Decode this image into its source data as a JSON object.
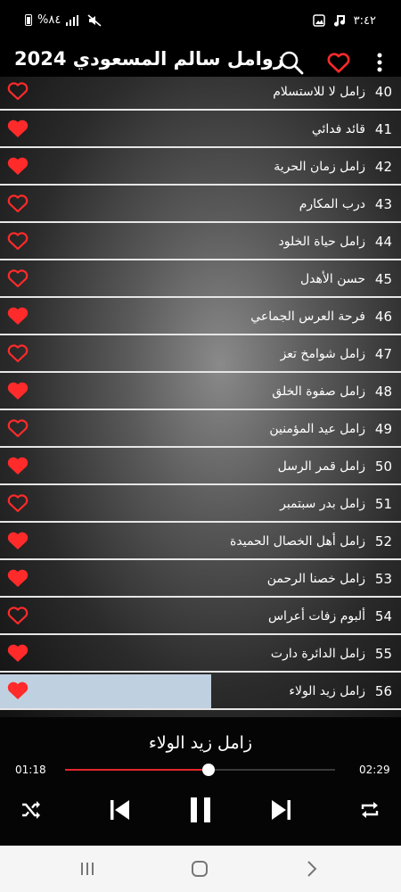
{
  "status_bar": {
    "time": "٣:٤٢",
    "battery": "%٨٤"
  },
  "app": {
    "title": "زوامل سالم المسعودي 2024"
  },
  "list": [
    {
      "num": "40",
      "title": "زامل لا للاستسلام",
      "fav": false
    },
    {
      "num": "41",
      "title": "قائد فدائي",
      "fav": true
    },
    {
      "num": "42",
      "title": "زامل زمان الحرية",
      "fav": true
    },
    {
      "num": "43",
      "title": "درب المكارم",
      "fav": false
    },
    {
      "num": "44",
      "title": "زامل حياة الخلود",
      "fav": false
    },
    {
      "num": "45",
      "title": "حسن الأهدل",
      "fav": false
    },
    {
      "num": "46",
      "title": "فرحة العرس الجماعي",
      "fav": true
    },
    {
      "num": "47",
      "title": "زامل شوامخ تعز",
      "fav": false
    },
    {
      "num": "48",
      "title": "زامل صفوة الخلق",
      "fav": true
    },
    {
      "num": "49",
      "title": "زامل عيد المؤمنين",
      "fav": false
    },
    {
      "num": "50",
      "title": "زامل قمر الرسل",
      "fav": true
    },
    {
      "num": "51",
      "title": "زامل بدر سبتمبر",
      "fav": false
    },
    {
      "num": "52",
      "title": "زامل أهل الخصال الحميدة",
      "fav": true
    },
    {
      "num": "53",
      "title": "زامل خصنا الرحمن",
      "fav": true
    },
    {
      "num": "54",
      "title": "ألبوم زفات أعراس",
      "fav": false
    },
    {
      "num": "55",
      "title": "زامل الدائرة دارت",
      "fav": true
    },
    {
      "num": "56",
      "title": "زامل زيد الولاء",
      "fav": true,
      "active": true
    }
  ],
  "player": {
    "now_playing": "زامل زيد الولاء",
    "elapsed": "01:18",
    "duration": "02:29",
    "progress": 0.53
  },
  "colors": {
    "heart": "#ff2a2a",
    "seek_fill": "#e3262b",
    "active_row": "#bfd0e0"
  }
}
